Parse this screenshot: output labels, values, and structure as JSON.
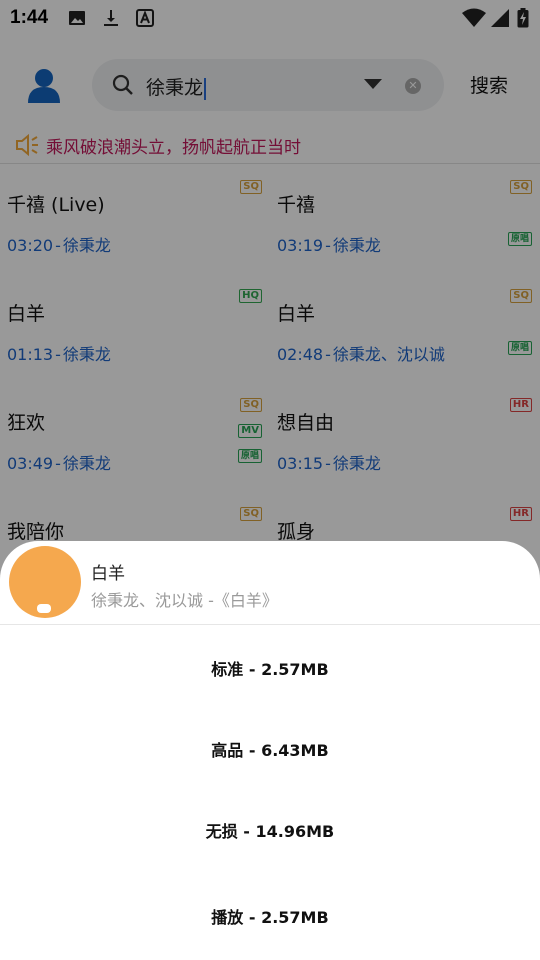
{
  "status_bar": {
    "time": "1:44",
    "left_icons": [
      "image-icon",
      "download-icon",
      "font-icon"
    ],
    "right_icons": [
      "wifi-icon",
      "cellular-icon",
      "battery-charging-icon"
    ]
  },
  "search": {
    "query": "徐秉龙",
    "button_label": "搜索"
  },
  "announcement": {
    "text": "乘风破浪潮头立，扬帆起航正当时",
    "color": "#c2185b"
  },
  "songs": [
    {
      "title": "千禧 (Live)",
      "duration": "03:20",
      "artist": "徐秉龙",
      "tags": [
        "SQ"
      ]
    },
    {
      "title": "千禧",
      "duration": "03:19",
      "artist": "徐秉龙",
      "tags": [
        "SQ",
        "原唱"
      ]
    },
    {
      "title": "白羊",
      "duration": "01:13",
      "artist": "徐秉龙",
      "tags": [
        "HQ"
      ]
    },
    {
      "title": "白羊",
      "duration": "02:48",
      "artist": "徐秉龙、沈以诚",
      "tags": [
        "SQ",
        "原唱"
      ]
    },
    {
      "title": "狂欢",
      "duration": "03:49",
      "artist": "徐秉龙",
      "tags": [
        "SQ",
        "MV",
        "原唱"
      ]
    },
    {
      "title": "想自由",
      "duration": "03:15",
      "artist": "徐秉龙",
      "tags": [
        "HR"
      ]
    },
    {
      "title": "我陪你",
      "duration": "",
      "artist": "",
      "tags": [
        "SQ"
      ]
    },
    {
      "title": "孤身",
      "duration": "",
      "artist": "",
      "tags": [
        "HR"
      ]
    }
  ],
  "sheet": {
    "title": "白羊",
    "subtitle": "徐秉龙、沈以诚 -《白羊》",
    "options": [
      {
        "label": "标准 - 2.57MB"
      },
      {
        "label": "高品 - 6.43MB"
      },
      {
        "label": "无损 - 14.96MB"
      },
      {
        "label": "播放 - 2.57MB"
      }
    ]
  },
  "colors": {
    "link_blue": "#1e63c9",
    "sq": "#d7a23e",
    "hq": "#34a853",
    "hr": "#d44",
    "cover": "#f5a84e"
  }
}
